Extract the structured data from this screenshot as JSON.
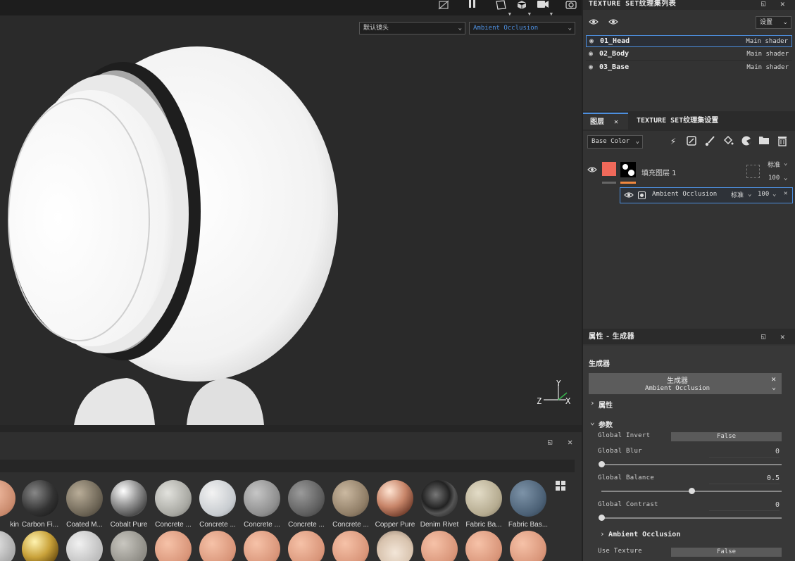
{
  "viewport": {
    "camera_select": "默认镜头",
    "channel_select": "Ambient Occlusion",
    "axes": {
      "x": "X",
      "y": "Y",
      "z": "Z"
    },
    "toolbar_icons": [
      "hide-icon",
      "pause-icon",
      "frame-icon",
      "cube-icon",
      "camera-icon",
      "screenshot-icon"
    ]
  },
  "texture_sets": {
    "title": "TEXTURE SET纹理集列表",
    "settings_button": "设置",
    "rows": [
      {
        "name": "01_Head",
        "shader": "Main shader"
      },
      {
        "name": "02_Body",
        "shader": "Main shader"
      },
      {
        "name": "03_Base",
        "shader": "Main shader"
      }
    ]
  },
  "layers": {
    "tab_layers": "图层",
    "tab_settings": "TEXTURE SET纹理集设置",
    "channel_select": "Base Color",
    "fill_layer": {
      "name": "填充图层 1",
      "blend": "标准",
      "opacity": "100"
    },
    "effect": {
      "name": "Ambient Occlusion",
      "blend": "标准",
      "opacity": "100"
    },
    "colors": {
      "fill": "#f0695a",
      "accent": "#4d8fdf",
      "opacity_bar": "#f0883e"
    }
  },
  "properties": {
    "title": "属性 - 生成器",
    "section": "生成器",
    "generator_title": "生成器",
    "generator_name": "Ambient Occlusion",
    "group_attributes": "属性",
    "group_params": "参数",
    "params": {
      "global_invert": {
        "label": "Global Invert",
        "value": "False"
      },
      "global_blur": {
        "label": "Global Blur",
        "value": "0",
        "fraction": 0
      },
      "global_balance": {
        "label": "Global Balance",
        "value": "0.5",
        "fraction": 0.5
      },
      "global_contrast": {
        "label": "Global Contrast",
        "value": "0",
        "fraction": 0
      }
    },
    "subgroup": "Ambient Occlusion",
    "use_texture": {
      "label": "Use Texture",
      "value": "False"
    }
  },
  "shelf": {
    "materials": [
      "kin",
      "Carbon Fi...",
      "Coated M...",
      "Cobalt Pure",
      "Concrete ...",
      "Concrete ...",
      "Concrete ...",
      "Concrete ...",
      "Concrete ...",
      "Copper Pure",
      "Denim Rivet",
      "Fabric Ba...",
      "Fabric Bas..."
    ]
  }
}
